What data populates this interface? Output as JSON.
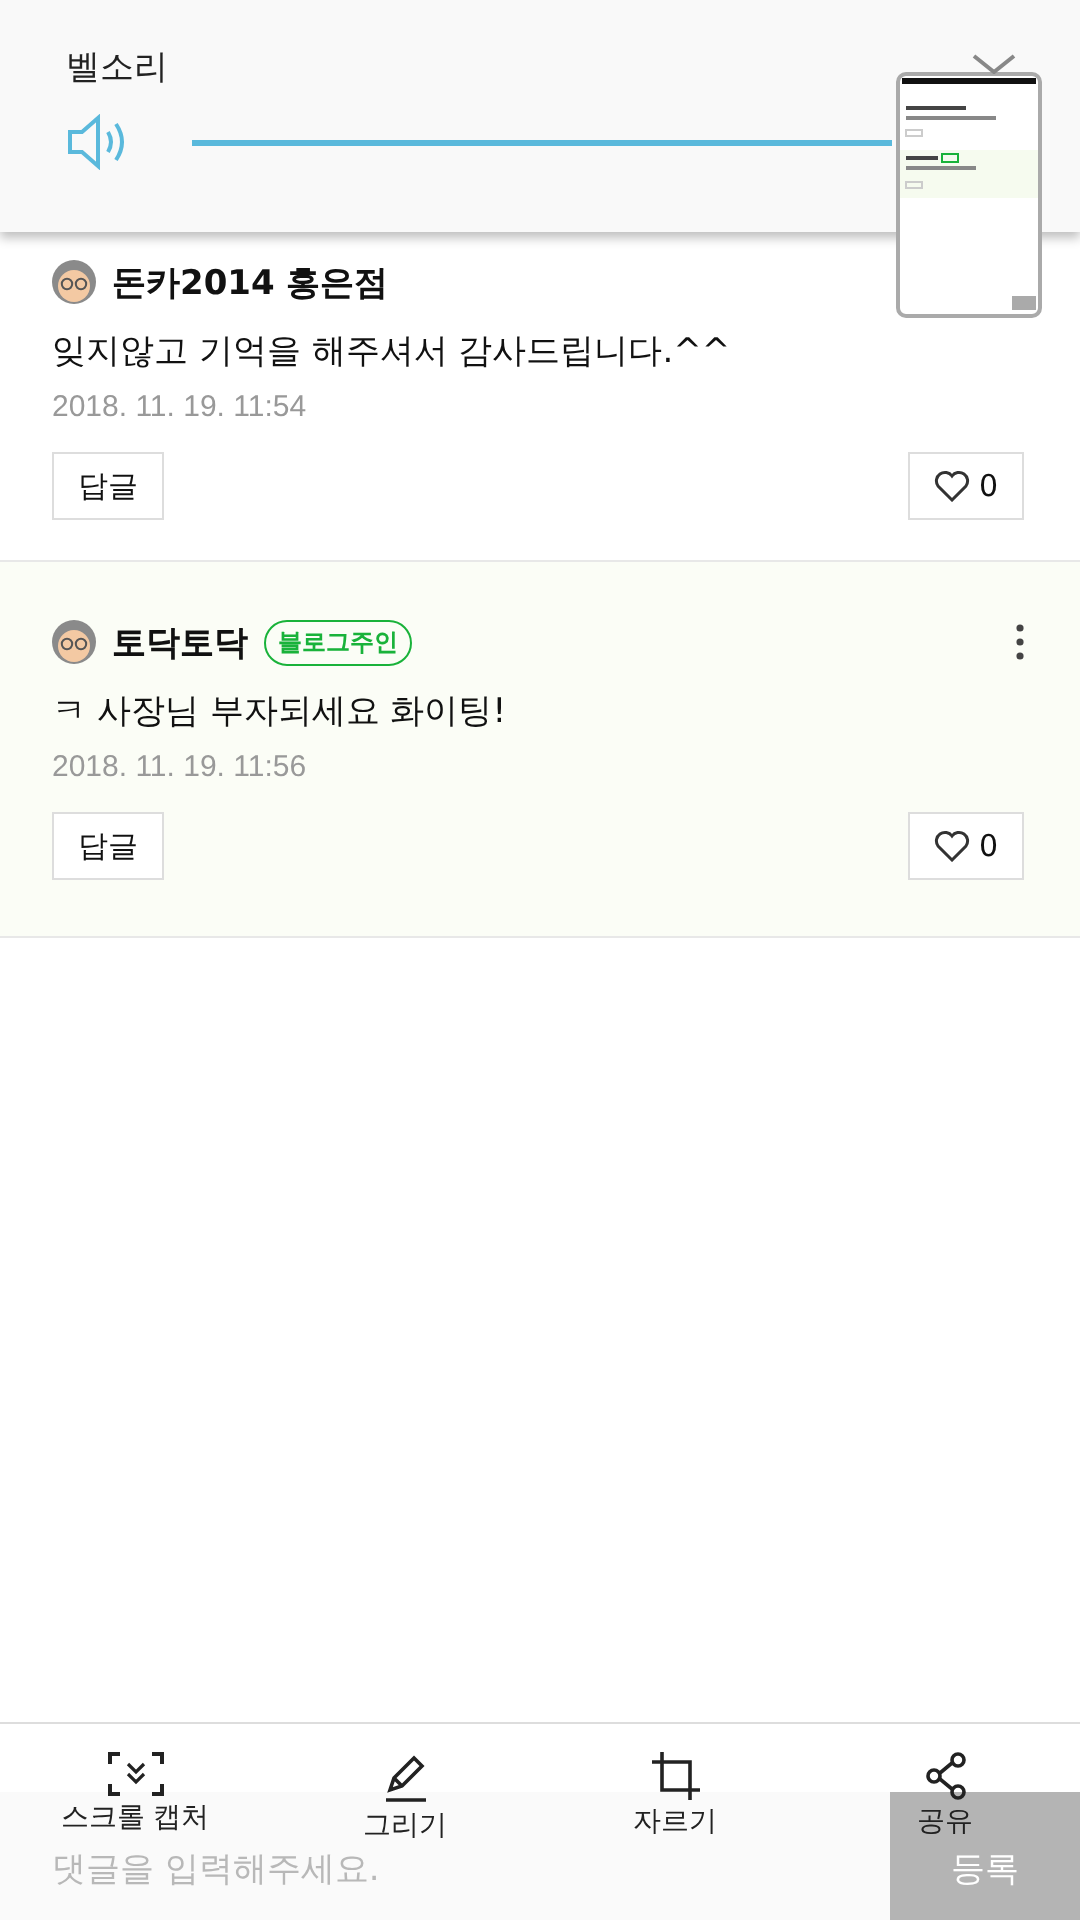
{
  "volume_panel": {
    "title": "벨소리",
    "level": 1
  },
  "comments": [
    {
      "author": "돈카2014 홍은점",
      "highlighted": false,
      "has_menu": false,
      "text": "잊지않고 기억을 해주셔서 감사드립니다.^^",
      "date": "2018. 11. 19. 11:54",
      "reply_label": "답글",
      "likes": "0"
    },
    {
      "author": "토닥토닥",
      "badge": "블로그주인",
      "highlighted": true,
      "has_menu": true,
      "text": "ㅋ   사장님  부자되세요 화이팅!",
      "date": "2018. 11. 19. 11:56",
      "reply_label": "답글",
      "likes": "0"
    }
  ],
  "comment_input": {
    "placeholder": "댓글을 입력해주세요.",
    "submit_label": "등록"
  },
  "capture_toolbar": [
    {
      "kind": "scroll",
      "label": "스크롤 캡처"
    },
    {
      "kind": "draw",
      "label": "그리기"
    },
    {
      "kind": "crop",
      "label": "자르기"
    },
    {
      "kind": "share",
      "label": "공유"
    }
  ]
}
